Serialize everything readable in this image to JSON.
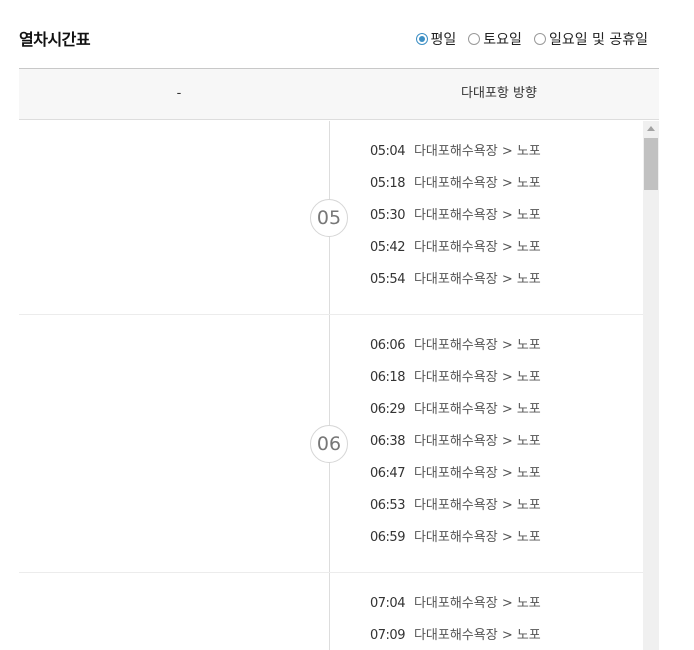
{
  "title": "열차시간표",
  "day_options": [
    {
      "label": "평일",
      "selected": true
    },
    {
      "label": "토요일",
      "selected": false
    },
    {
      "label": "일요일 및 공휴일",
      "selected": false
    }
  ],
  "table_header": {
    "left": "-",
    "right": "다대포항 방향"
  },
  "accent_color": "#3d8fc4",
  "hours": [
    {
      "hour": "05",
      "trains": [
        {
          "time": "05:04",
          "route": "다대포해수욕장 > 노포"
        },
        {
          "time": "05:18",
          "route": "다대포해수욕장 > 노포"
        },
        {
          "time": "05:30",
          "route": "다대포해수욕장 > 노포"
        },
        {
          "time": "05:42",
          "route": "다대포해수욕장 > 노포"
        },
        {
          "time": "05:54",
          "route": "다대포해수욕장 > 노포"
        }
      ]
    },
    {
      "hour": "06",
      "trains": [
        {
          "time": "06:06",
          "route": "다대포해수욕장 > 노포"
        },
        {
          "time": "06:18",
          "route": "다대포해수욕장 > 노포"
        },
        {
          "time": "06:29",
          "route": "다대포해수욕장 > 노포"
        },
        {
          "time": "06:38",
          "route": "다대포해수욕장 > 노포"
        },
        {
          "time": "06:47",
          "route": "다대포해수욕장 > 노포"
        },
        {
          "time": "06:53",
          "route": "다대포해수욕장 > 노포"
        },
        {
          "time": "06:59",
          "route": "다대포해수욕장 > 노포"
        }
      ]
    },
    {
      "hour": "07",
      "trains": [
        {
          "time": "07:04",
          "route": "다대포해수욕장 > 노포"
        },
        {
          "time": "07:09",
          "route": "다대포해수욕장 > 노포"
        }
      ]
    }
  ]
}
